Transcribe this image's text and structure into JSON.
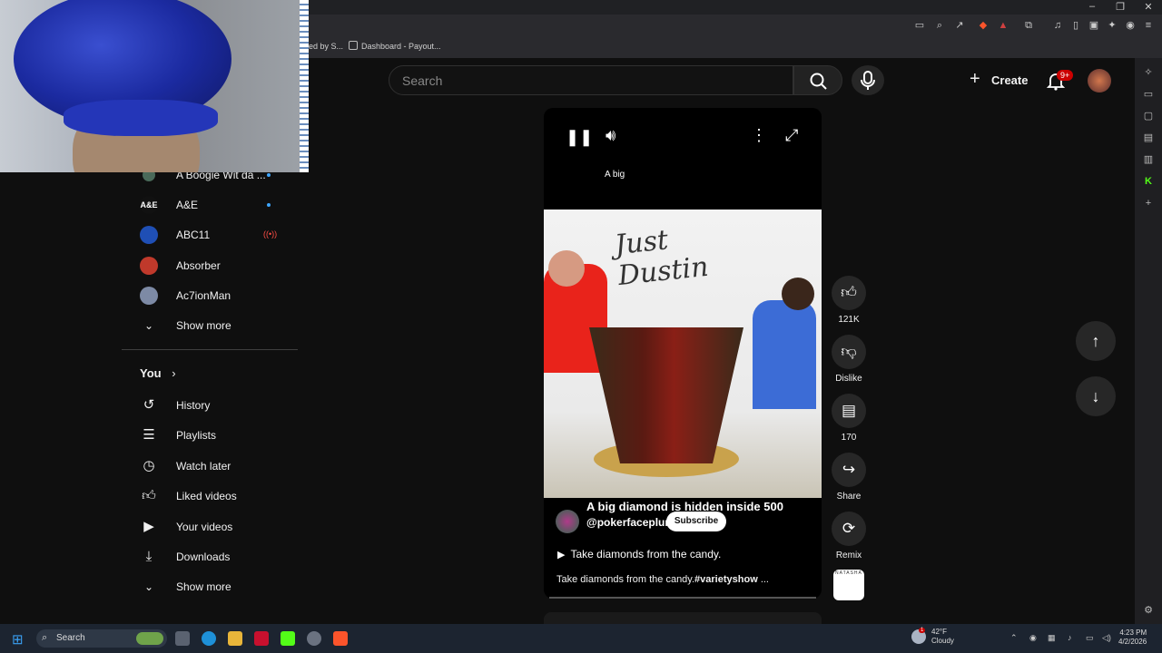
{
  "browser": {
    "bookmarks": [
      "ed by S...",
      "Dashboard - Payout..."
    ],
    "window_controls": [
      "–",
      "❐",
      "✕"
    ]
  },
  "header": {
    "search_placeholder": "Search",
    "create_label": "Create",
    "notifications_badge": "9+"
  },
  "sidebar": {
    "subscriptions": [
      {
        "label": "A Boogie Wit da ...",
        "indicator": "new"
      },
      {
        "label": "A&E",
        "indicator": "new"
      },
      {
        "label": "ABC11",
        "indicator": "live"
      },
      {
        "label": "Absorber",
        "indicator": ""
      },
      {
        "label": "Ac7ionMan",
        "indicator": ""
      }
    ],
    "show_more_1": "Show more",
    "you_title": "You",
    "you_items": [
      {
        "label": "History",
        "icon": "history-icon"
      },
      {
        "label": "Playlists",
        "icon": "playlists-icon"
      },
      {
        "label": "Watch later",
        "icon": "watch-later-icon"
      },
      {
        "label": "Liked videos",
        "icon": "thumbs-up-icon"
      },
      {
        "label": "Your videos",
        "icon": "your-videos-icon"
      },
      {
        "label": "Downloads",
        "icon": "download-icon"
      }
    ],
    "show_more_2": "Show more"
  },
  "short": {
    "top_caption": "A big",
    "video_text": "Just\nDustin",
    "title": "A big diamond is hidden inside 500",
    "channel": "@pokerfaceplum",
    "subscribe_label": "Subscribe",
    "related_label": "Take diamonds from the candy.",
    "description": "Take diamonds from the candy.",
    "hashtag": "#varietyshow",
    "description_more": "..."
  },
  "actions": {
    "like_count": "121K",
    "dislike_label": "Dislike",
    "comment_count": "170",
    "share_label": "Share",
    "remix_label": "Remix",
    "audio_label": "NATASHA"
  },
  "taskbar": {
    "search_label": "Search",
    "weather_temp": "42°F",
    "weather_desc": "Cloudy",
    "weather_badge": "1",
    "time": "4:23 PM",
    "date": "4/2/2026"
  },
  "colors": {
    "background": "#0f0f0f",
    "accent_red": "#cc0000",
    "link_blue": "#3ea6ff"
  }
}
